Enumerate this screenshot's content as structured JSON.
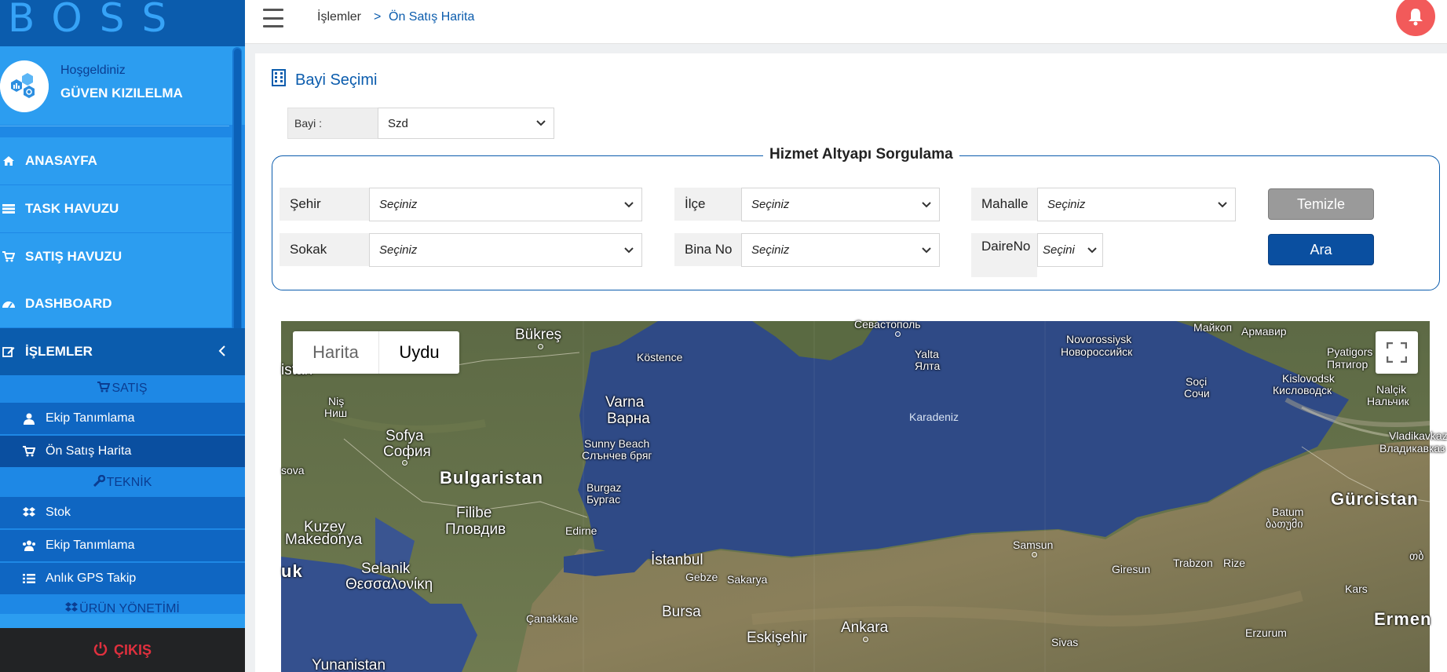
{
  "app": {
    "logo": "BOSS"
  },
  "profile": {
    "welcome": "Hoşgeldiniz",
    "name": "GÜVEN KIZILELMA"
  },
  "nav": {
    "main": [
      {
        "label": "ANASAYFA",
        "icon": "home-icon"
      },
      {
        "label": "TASK HAVUZU",
        "icon": "list-icon"
      },
      {
        "label": "SATIŞ HAVUZU",
        "icon": "cart-icon"
      },
      {
        "label": "DASHBOARD",
        "icon": "dashboard-icon"
      },
      {
        "label": "İŞLEMLER",
        "icon": "edit-icon"
      }
    ],
    "satis_header": "SATIŞ",
    "satis_items": [
      {
        "label": "Ekip Tanımlama",
        "icon": "user-icon"
      },
      {
        "label": "Ön Satış Harita",
        "icon": "cart-icon"
      }
    ],
    "teknik_header": "TEKNİK",
    "teknik_items": [
      {
        "label": "Stok",
        "icon": "dropbox-icon"
      },
      {
        "label": "Ekip Tanımlama",
        "icon": "users-icon"
      },
      {
        "label": "Anlık GPS Takip",
        "icon": "list-icon"
      }
    ],
    "urun_header": "ÜRÜN YÖNETİMİ",
    "logout": "ÇIKIŞ"
  },
  "header": {
    "breadcrumb": [
      "İşlemler",
      "Ön Satış Harita"
    ],
    "breadcrumb_sep": ">"
  },
  "bayi": {
    "title": "Bayi Seçimi",
    "label": "Bayi :",
    "value": "Szd"
  },
  "query": {
    "legend": "Hizmet Altyapı Sorgulama",
    "fields": {
      "sehir": {
        "label": "Şehir",
        "value": "Seçiniz"
      },
      "ilce": {
        "label": "İlçe",
        "value": "Seçiniz"
      },
      "mahalle": {
        "label": "Mahalle",
        "value": "Seçiniz"
      },
      "sokak": {
        "label": "Sokak",
        "value": "Seçiniz"
      },
      "bina_no": {
        "label": "Bina No",
        "value": "Seçiniz"
      },
      "daire_no": {
        "label_line1": "Daire",
        "label_line2": "No",
        "value": "Seçini"
      }
    },
    "clear_button": "Temizle",
    "search_button": "Ara"
  },
  "map": {
    "type_options": [
      "Harita",
      "Uydu"
    ],
    "selected_type": "Uydu",
    "labels": {
      "istan": "istan",
      "bukres": "Bükreş",
      "kostence": "Köstence",
      "sevastopol": "Севастополь",
      "yalta1": "Yalta",
      "yalta2": "Ялта",
      "novo1": "Novorossiysk",
      "novo2": "Новороссийск",
      "maykop": "Майкоп",
      "armavir": "Армавир",
      "pyatigorsk1": "Pyatigors",
      "pyatigorsk2": "Пятигор",
      "soci1": "Soçi",
      "soci2": "Сочи",
      "kislovodsk1": "Kislovodsk",
      "kislovodsk2": "Кисловодск",
      "nalcik1": "Nalçik",
      "nalcik2": "Нальчик",
      "nis1": "Niş",
      "nis2": "Ниш",
      "varna1": "Varna",
      "varna2": "Варна",
      "karadeniz": "Karadeniz",
      "vladikavkaz1": "Vladikavkaz",
      "vladikavkaz2": "Владикавказ",
      "sofya1": "Sofya",
      "sofya2": "София",
      "sunnybeach1": "Sunny Beach",
      "sunnybeach2": "Слънчев бряг",
      "sova": "sova",
      "bulgaristan": "Bulgaristan",
      "burgaz1": "Burgaz",
      "burgaz2": "Бургас",
      "gurcistan": "Gürcistan",
      "batum1": "Batum",
      "batum2": "ბათუმი",
      "filibe1": "Filibe",
      "filibe2": "Пловдив",
      "kuzey1": "Kuzey",
      "kuzey2": "Makedonya",
      "edirne": "Edirne",
      "samsun": "Samsun",
      "istanbul": "İstanbul",
      "giresun": "Giresun",
      "trabzon": "Trabzon",
      "rize": "Rize",
      "uk": "uk",
      "selanik1": "Selanik",
      "selanik2": "Θεσσαλονίκη",
      "gebze": "Gebze",
      "sakarya": "Sakarya",
      "kars": "Kars",
      "canakkale": "Çanakkale",
      "bursa": "Bursa",
      "ankara": "Ankara",
      "ermeni": "Ermen",
      "erzurum": "Erzurum",
      "eskisehir": "Eskişehir",
      "sivas": "Sivas",
      "yunanistan": "Yunanistan",
      "georgian_edge": "თბ"
    }
  },
  "colors": {
    "sidebar": "#1e88e5",
    "sidebar_dark": "#0b5cad",
    "accent": "#0b5cad",
    "clear_button": "#9a9a9a",
    "search_button": "#0a4fa0",
    "logout_text": "#e0303e",
    "bell": "#f25a5a"
  }
}
